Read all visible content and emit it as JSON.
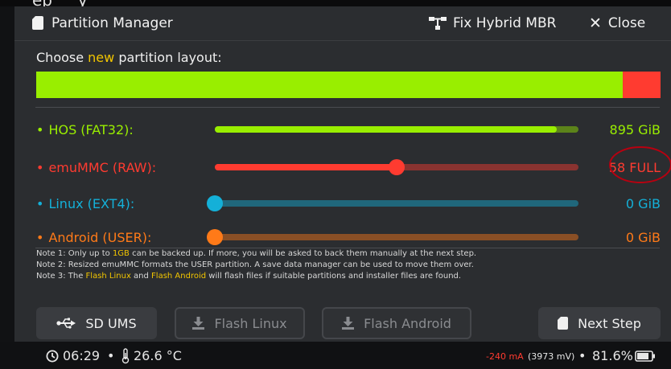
{
  "top_strip_text": "ep     y",
  "window": {
    "title": "Partition Manager",
    "fix_hybrid_mbr": "Fix Hybrid MBR",
    "close": "Close"
  },
  "layout": {
    "choose_prefix": "Choose ",
    "choose_highlight": "new",
    "choose_suffix": " partition layout:",
    "bar_segments": [
      {
        "name": "HOS",
        "color": "#99ee00",
        "fraction": 0.939
      },
      {
        "name": "emuMMC",
        "color": "#ff3b30",
        "fraction": 0.061
      }
    ]
  },
  "partitions": [
    {
      "bullet": "•",
      "label": "HOS (FAT32):",
      "value": "895 GiB",
      "color": "#99ee00",
      "level": 0.94
    },
    {
      "bullet": "•",
      "label": "emuMMC (RAW):",
      "value": "58 FULL",
      "color": "#ff3b30",
      "level": 0.5
    },
    {
      "bullet": "•",
      "label": "Linux (EXT4):",
      "value": "0 GiB",
      "color": "#14b0d8",
      "level": 0.0
    },
    {
      "bullet": "•",
      "label": "Android (USER):",
      "value": "0 GiB",
      "color": "#ff7a18",
      "level": 0.0
    }
  ],
  "notes": {
    "note1_a": "Note 1: Only up to ",
    "note1_hl": "1GB",
    "note1_b": " can be backed up. If more, you will be asked to back them manually at the next step.",
    "note2": "Note 2: Resized emuMMC formats the USER partition. A save data manager can be used to move them over.",
    "note3_a": "Note 3: The ",
    "note3_hl1": "Flash Linux",
    "note3_b": " and ",
    "note3_hl2": "Flash Android",
    "note3_c": " will flash files if suitable partitions and installer files are found."
  },
  "buttons": {
    "sd_ums": "SD UMS",
    "flash_linux": "Flash Linux",
    "flash_android": "Flash Android",
    "next_step": "Next Step"
  },
  "status": {
    "time": "06:29",
    "dot": "•",
    "temperature": "26.6 °C",
    "current": "-240 mA",
    "voltage": "(3973 mV)",
    "dot2": "•",
    "battery": "81.6%"
  },
  "colors": {
    "highlight_yellow": "#f2c500",
    "annotation_red": "#b80010"
  },
  "icons": [
    "sd-card-icon",
    "network-icon",
    "close-icon",
    "usb-icon",
    "download-icon",
    "clock-icon",
    "thermometer-icon",
    "battery-icon"
  ]
}
